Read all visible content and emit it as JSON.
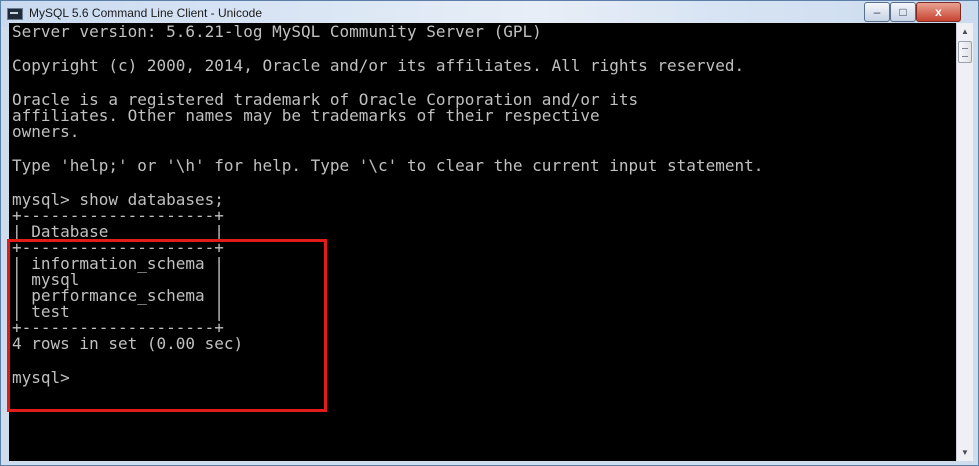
{
  "window": {
    "title": "MySQL 5.6 Command Line Client - Unicode",
    "controls": {
      "minimize": "–",
      "maximize": "□",
      "close": "x"
    }
  },
  "console": {
    "lines": [
      "Server version: 5.6.21-log MySQL Community Server (GPL)",
      "Copyright (c) 2000, 2014, Oracle and/or its affiliates. All rights reserved.",
      "Oracle is a registered trademark of Oracle Corporation and/or its",
      "affiliates. Other names may be trademarks of their respective",
      "owners.",
      "Type 'help;' or '\\h' for help. Type '\\c' to clear the current input statement.",
      "mysql> show databases;",
      "+--------------------+",
      "| Database           |",
      "+--------------------+",
      "| information_schema |",
      "| mysql              |",
      "| performance_schema |",
      "| test               |",
      "+--------------------+",
      "4 rows in set (0.00 sec)",
      "mysql>"
    ]
  },
  "scrollbar": {
    "up_arrow": "▲",
    "down_arrow": "▼"
  },
  "colors": {
    "console_background": "#000000",
    "console_text": "#c0c0c0",
    "highlight_border": "#e21b1b"
  }
}
